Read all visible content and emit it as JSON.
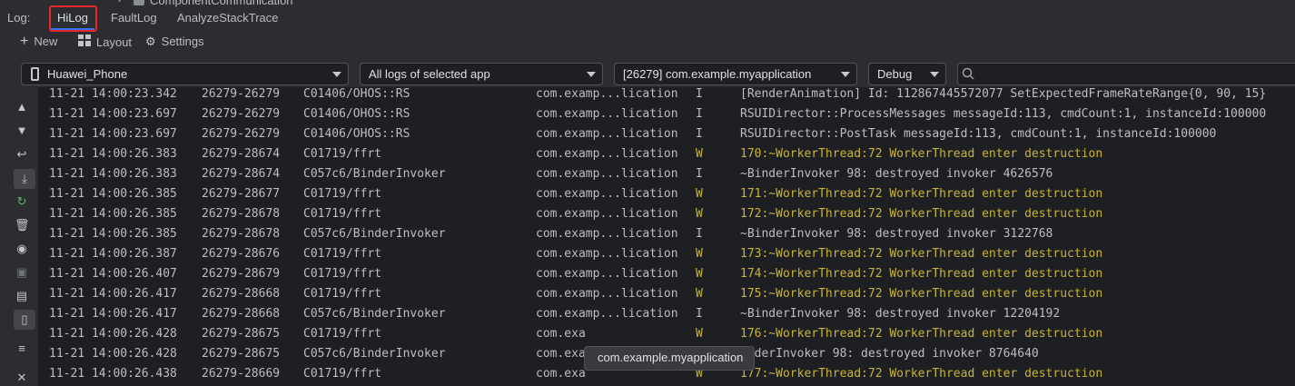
{
  "crumb": {
    "text": "ComponentCommunication"
  },
  "tabs": {
    "log_label": "Log:",
    "hilog": "HiLog",
    "faultlog": "FaultLog",
    "analyze": "AnalyzeStackTrace"
  },
  "toolbar": {
    "new_label": "New",
    "layout_label": "Layout",
    "settings_label": "Settings"
  },
  "filters": {
    "device": "Huawei_Phone",
    "scope": "All logs of selected app",
    "process": "[26279] com.example.myapplication",
    "level": "Debug",
    "search_placeholder": ""
  },
  "colors": {
    "accent": "#3574f0",
    "highlight_box": "#e5262a",
    "warn_text": "#c9b33a",
    "info_text": "#bcbec4"
  },
  "logs": [
    {
      "time": "11-21 14:00:23.342",
      "pid": "26279-26279",
      "tag": "C01406/OHOS::RS",
      "pkg": "com.examp...lication",
      "level": "I",
      "msg": "[RenderAnimation] Id: 112867445572077 SetExpectedFrameRateRange{0, 90, 15}"
    },
    {
      "time": "11-21 14:00:23.697",
      "pid": "26279-26279",
      "tag": "C01406/OHOS::RS",
      "pkg": "com.examp...lication",
      "level": "I",
      "msg": "RSUIDirector::ProcessMessages messageId:113, cmdCount:1, instanceId:100000"
    },
    {
      "time": "11-21 14:00:23.697",
      "pid": "26279-26279",
      "tag": "C01406/OHOS::RS",
      "pkg": "com.examp...lication",
      "level": "I",
      "msg": "RSUIDirector::PostTask messageId:113, cmdCount:1, instanceId:100000"
    },
    {
      "time": "11-21 14:00:26.383",
      "pid": "26279-28674",
      "tag": "C01719/ffrt",
      "pkg": "com.examp...lication",
      "level": "W",
      "msg": "170:~WorkerThread:72 WorkerThread enter destruction"
    },
    {
      "time": "11-21 14:00:26.383",
      "pid": "26279-28674",
      "tag": "C057c6/BinderInvoker",
      "pkg": "com.examp...lication",
      "level": "I",
      "msg": "~BinderInvoker 98: destroyed invoker 4626576"
    },
    {
      "time": "11-21 14:00:26.385",
      "pid": "26279-28677",
      "tag": "C01719/ffrt",
      "pkg": "com.examp...lication",
      "level": "W",
      "msg": "171:~WorkerThread:72 WorkerThread enter destruction"
    },
    {
      "time": "11-21 14:00:26.385",
      "pid": "26279-28678",
      "tag": "C01719/ffrt",
      "pkg": "com.examp...lication",
      "level": "W",
      "msg": "172:~WorkerThread:72 WorkerThread enter destruction"
    },
    {
      "time": "11-21 14:00:26.385",
      "pid": "26279-28678",
      "tag": "C057c6/BinderInvoker",
      "pkg": "com.examp...lication",
      "level": "I",
      "msg": "~BinderInvoker 98: destroyed invoker 3122768"
    },
    {
      "time": "11-21 14:00:26.387",
      "pid": "26279-28676",
      "tag": "C01719/ffrt",
      "pkg": "com.examp...lication",
      "level": "W",
      "msg": "173:~WorkerThread:72 WorkerThread enter destruction"
    },
    {
      "time": "11-21 14:00:26.407",
      "pid": "26279-28679",
      "tag": "C01719/ffrt",
      "pkg": "com.examp...lication",
      "level": "W",
      "msg": "174:~WorkerThread:72 WorkerThread enter destruction"
    },
    {
      "time": "11-21 14:00:26.417",
      "pid": "26279-28668",
      "tag": "C01719/ffrt",
      "pkg": "com.examp...lication",
      "level": "W",
      "msg": "175:~WorkerThread:72 WorkerThread enter destruction"
    },
    {
      "time": "11-21 14:00:26.417",
      "pid": "26279-28668",
      "tag": "C057c6/BinderInvoker",
      "pkg": "com.examp...lication",
      "level": "I",
      "msg": "~BinderInvoker 98: destroyed invoker 12204192"
    },
    {
      "time": "11-21 14:00:26.428",
      "pid": "26279-28675",
      "tag": "C01719/ffrt",
      "pkg": "com.exa",
      "level": "W",
      "msg": "176:~WorkerThread:72 WorkerThread enter destruction"
    },
    {
      "time": "11-21 14:00:26.428",
      "pid": "26279-28675",
      "tag": "C057c6/BinderInvoker",
      "pkg": "com.exa",
      "level": "I",
      "msg": "inderInvoker 98: destroyed invoker 8764640"
    },
    {
      "time": "11-21 14:00:26.438",
      "pid": "26279-28669",
      "tag": "C01719/ffrt",
      "pkg": "com.exa",
      "level": "W",
      "msg": "177:~WorkerThread:72 WorkerThread enter destruction"
    }
  ],
  "tooltip": {
    "text": "com.example.myapplication"
  }
}
